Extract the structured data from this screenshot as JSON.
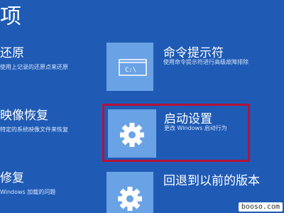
{
  "header": {
    "title": "项"
  },
  "left_options": [
    {
      "title": "还原",
      "desc": "使用上记录的还原点来还原"
    },
    {
      "title": "映像恢复",
      "desc": "特定的系统映像文件来恢复"
    },
    {
      "title": "修复",
      "desc": "Windows 加载的问题"
    }
  ],
  "right_options": [
    {
      "title": "命令提示符",
      "desc": "使用命令提示符进行高级故障排除",
      "icon": "command-prompt-icon",
      "icon_text": "C:\\"
    },
    {
      "title": "启动设置",
      "desc": "更改 Windows 启动行为",
      "icon": "gear-icon"
    },
    {
      "title": "回退到以前的版本",
      "desc": "",
      "icon": "gear-icon"
    }
  ],
  "watermark": "booso.com",
  "colors": {
    "background": "#1f5bb5",
    "tile": "#6aa2e6",
    "highlight": "#b4123a"
  }
}
